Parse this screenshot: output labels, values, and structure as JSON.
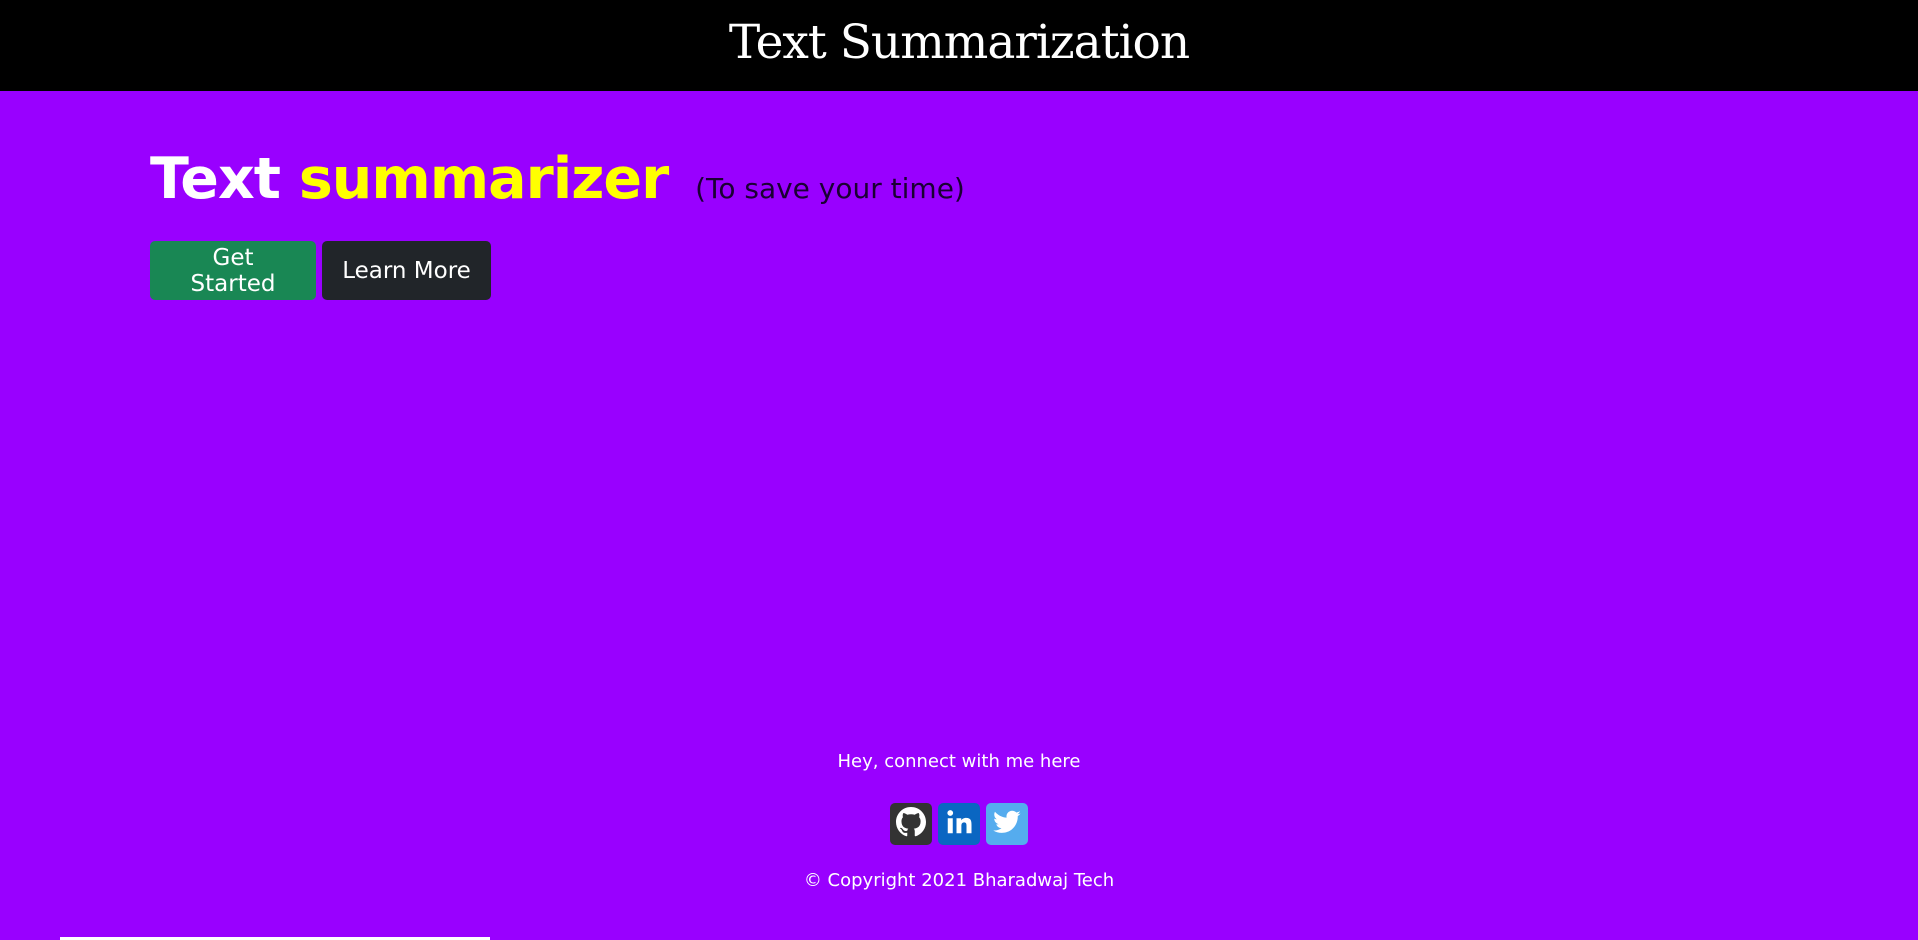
{
  "header": {
    "title": "Text Summarization"
  },
  "hero": {
    "word_1": "Text",
    "word_2": "summarizer",
    "tagline": "(To save your time)"
  },
  "buttons": {
    "get_started": "Get Started",
    "learn_more": "Learn More"
  },
  "footer": {
    "connect_text": "Hey, connect with me here",
    "social": [
      {
        "name": "github-icon"
      },
      {
        "name": "linkedin-icon"
      },
      {
        "name": "twitter-icon"
      }
    ],
    "copyright": "© Copyright 2021 Bharadwaj Tech"
  },
  "colors": {
    "page_background": "#9900ff",
    "header_background": "#000000",
    "accent_yellow": "#ffff00",
    "start_button": "#198754",
    "learn_button": "#212529",
    "github": "#333333",
    "linkedin": "#0a66c2",
    "twitter": "#55acee"
  }
}
